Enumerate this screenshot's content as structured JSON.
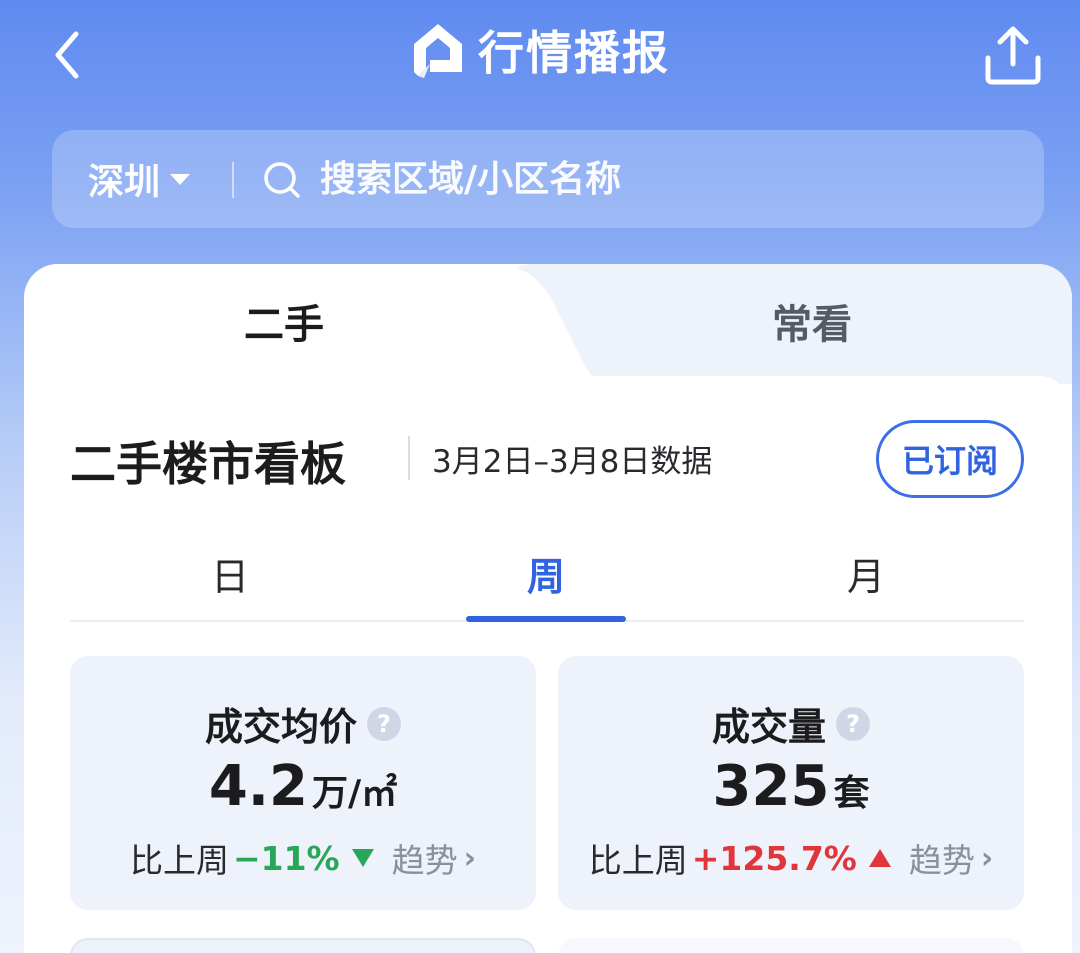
{
  "header": {
    "title": "行情播报",
    "colors": {
      "accent": "#2f63e0",
      "header_bg": "#5f8af0"
    }
  },
  "search": {
    "city": "深圳",
    "placeholder": "搜索区域/小区名称"
  },
  "main_tabs": [
    {
      "label": "二手",
      "active": true
    },
    {
      "label": "常看",
      "active": false
    }
  ],
  "board": {
    "title": "二手楼市看板",
    "date_range": "3月2日–3月8日数据",
    "subscribe_label": "已订阅"
  },
  "period_tabs": [
    {
      "label": "日",
      "active": false
    },
    {
      "label": "周",
      "active": true
    },
    {
      "label": "月",
      "active": false
    }
  ],
  "stats": [
    {
      "label": "成交均价",
      "value": "4.2",
      "unit": "万/㎡",
      "compare_label": "比上周",
      "change": "−11%",
      "direction": "down",
      "trend_label": "趋势"
    },
    {
      "label": "成交量",
      "value": "325",
      "unit": "套",
      "compare_label": "比上周",
      "change": "+125.7%",
      "direction": "up",
      "trend_label": "趋势"
    }
  ],
  "icons": {
    "back": "back-arrow-icon",
    "logo": "house-logo-icon",
    "share": "share-icon",
    "search": "search-icon",
    "help": "help-icon",
    "trend_chevron": "chevron-right-icon"
  }
}
